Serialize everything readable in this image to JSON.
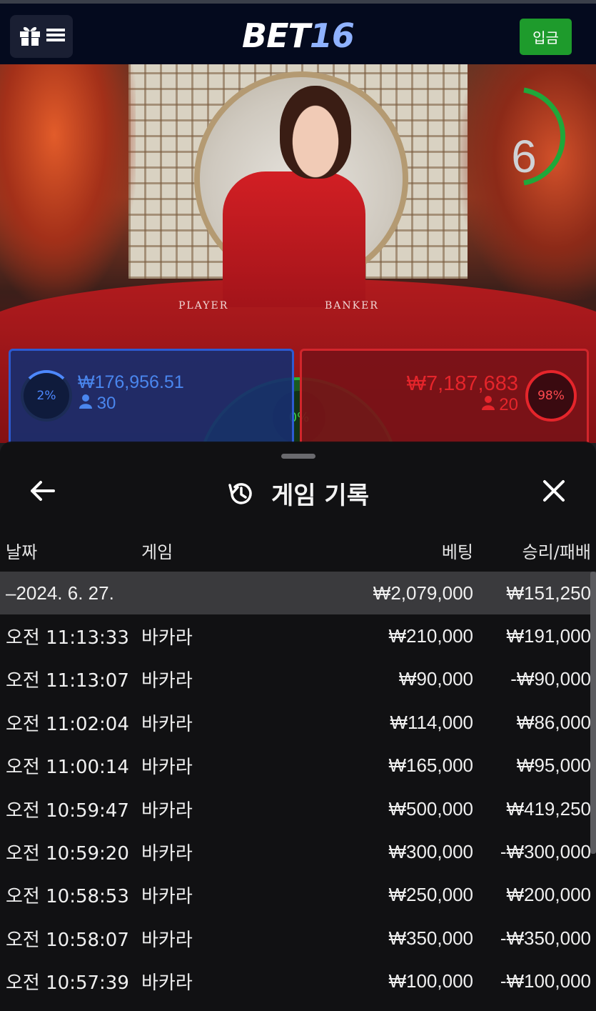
{
  "header": {
    "logo_a": "BET",
    "logo_b": "16",
    "deposit_label": "입금"
  },
  "video": {
    "countdown": "6",
    "felt_player": "PLAYER",
    "felt_banker": "BANKER"
  },
  "bets": {
    "player": {
      "percent": "2%",
      "amount": "₩176,956.51",
      "count": "30"
    },
    "tie": {
      "percent": "0%"
    },
    "banker": {
      "percent": "98%",
      "amount": "₩7,187,683",
      "count": "20"
    }
  },
  "colors": {
    "player": "#2d5bd1",
    "banker": "#d2262c",
    "tie": "#27b43a",
    "deposit": "#1e9b2c"
  },
  "sheet": {
    "title": "게임 기록",
    "columns": {
      "date": "날짜",
      "game": "게임",
      "bet": "베팅",
      "result": "승리/패배"
    },
    "summary": {
      "date": "–2024. 6. 27.",
      "bet": "₩2,079,000",
      "result": "₩151,250"
    },
    "rows": [
      {
        "time": "오전 11:13:33",
        "game": "바카라",
        "bet": "₩210,000",
        "result": "₩191,000"
      },
      {
        "time": "오전 11:13:07",
        "game": "바카라",
        "bet": "₩90,000",
        "result": "-₩90,000"
      },
      {
        "time": "오전 11:02:04",
        "game": "바카라",
        "bet": "₩114,000",
        "result": "₩86,000"
      },
      {
        "time": "오전 11:00:14",
        "game": "바카라",
        "bet": "₩165,000",
        "result": "₩95,000"
      },
      {
        "time": "오전 10:59:47",
        "game": "바카라",
        "bet": "₩500,000",
        "result": "₩419,250"
      },
      {
        "time": "오전 10:59:20",
        "game": "바카라",
        "bet": "₩300,000",
        "result": "-₩300,000"
      },
      {
        "time": "오전 10:58:53",
        "game": "바카라",
        "bet": "₩250,000",
        "result": "₩200,000"
      },
      {
        "time": "오전 10:58:07",
        "game": "바카라",
        "bet": "₩350,000",
        "result": "-₩350,000"
      },
      {
        "time": "오전 10:57:39",
        "game": "바카라",
        "bet": "₩100,000",
        "result": "-₩100,000"
      }
    ]
  }
}
